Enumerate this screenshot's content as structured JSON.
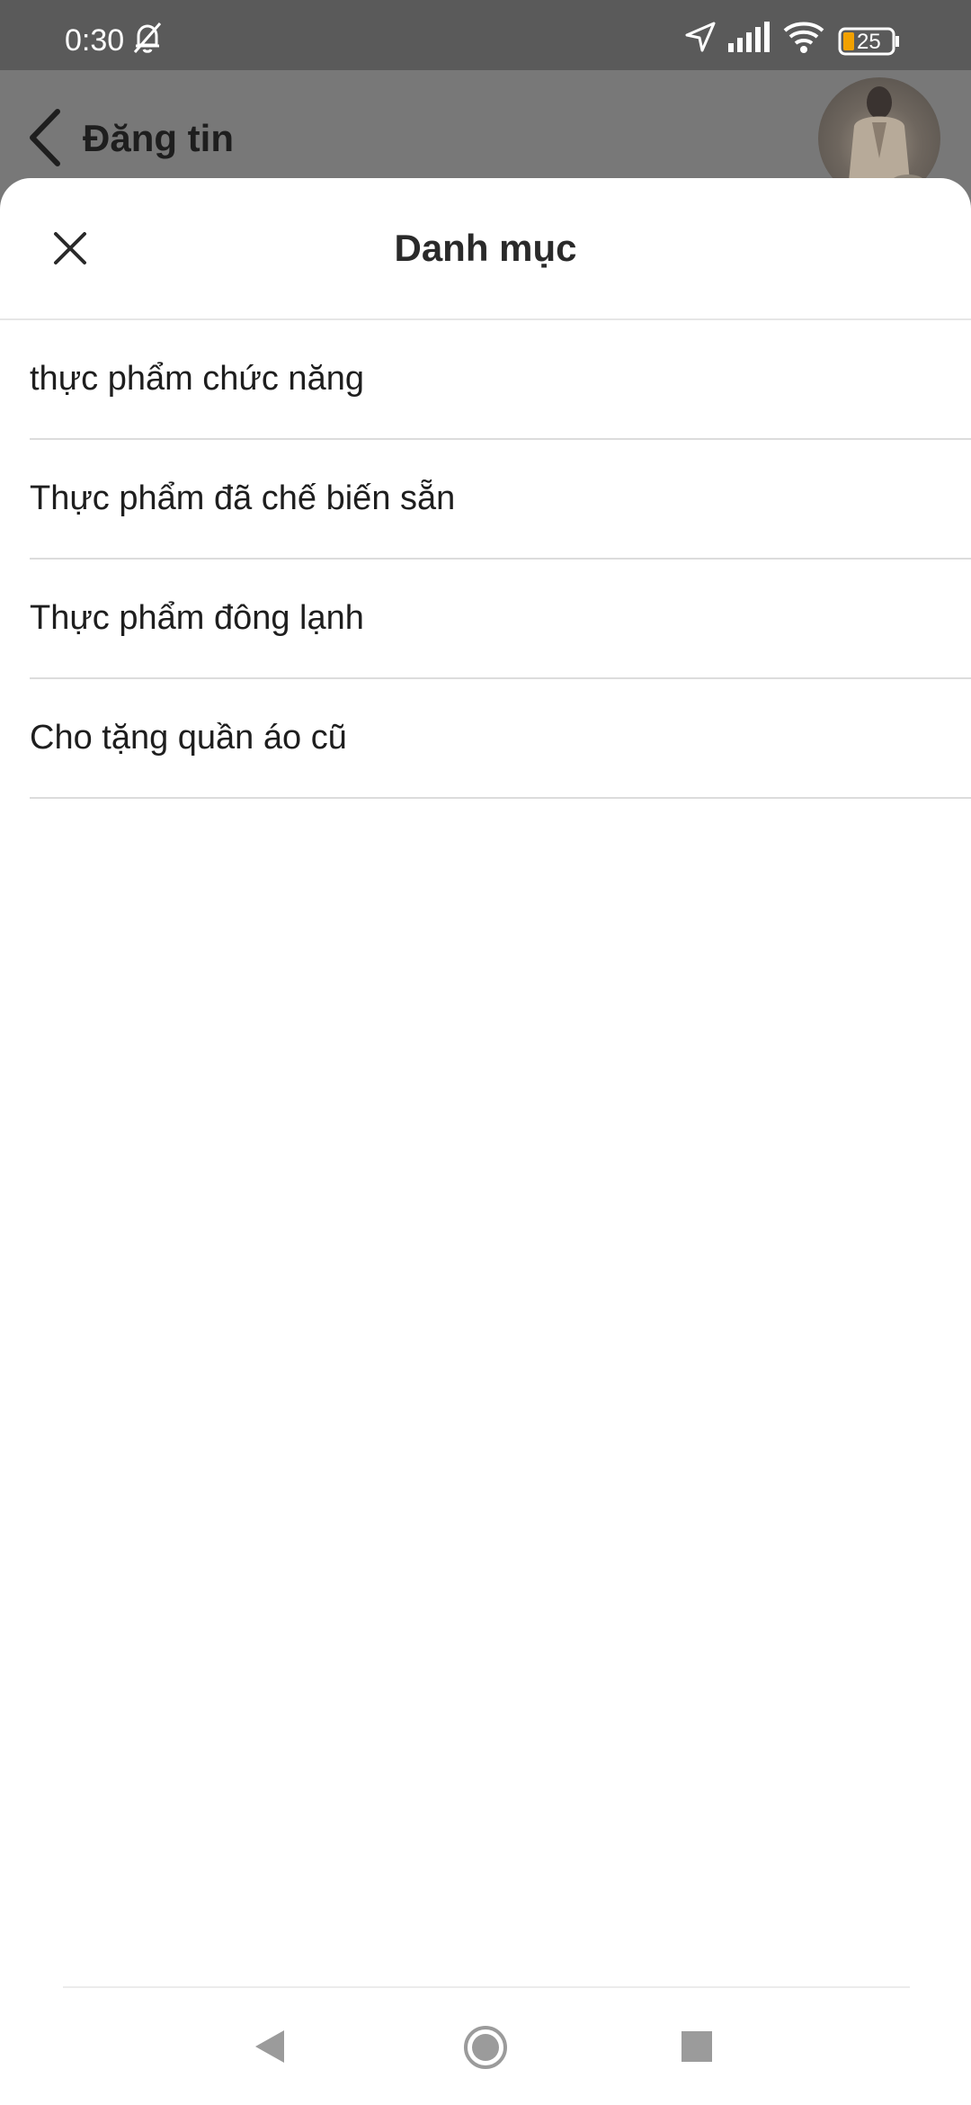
{
  "status_bar": {
    "time": "0:30",
    "battery": "25",
    "icons": [
      "bell-muted-icon",
      "location-arrow-icon",
      "signal-icon",
      "wifi-icon",
      "battery-icon"
    ]
  },
  "header": {
    "title": "Đăng tin",
    "back_icon": "chevron-left-icon"
  },
  "sheet": {
    "title": "Danh mục",
    "close_icon": "close-icon",
    "items": [
      {
        "label": "thực phẩm chức năng"
      },
      {
        "label": "Thực phẩm đã chế biến sẵn"
      },
      {
        "label": "Thực phẩm đông lạnh"
      },
      {
        "label": "Cho tặng quần áo cũ"
      }
    ]
  },
  "nav_bar": {
    "icons": [
      "nav-back-icon",
      "nav-home-icon",
      "nav-recents-icon"
    ]
  },
  "colors": {
    "status_bar": "#5a5a5a",
    "overlay": "#787878",
    "sheet_bg": "#ffffff",
    "divider": "#dcdcdc"
  }
}
